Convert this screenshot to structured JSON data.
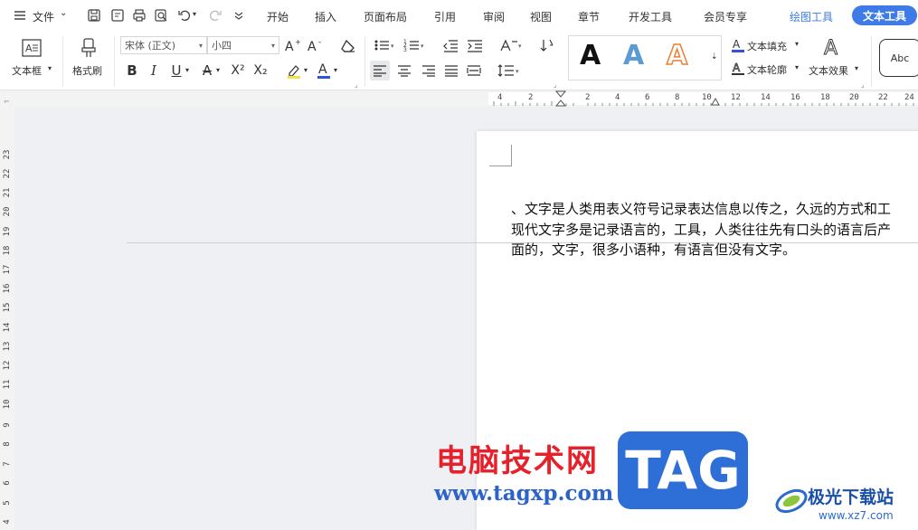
{
  "menubar": {
    "file_label": "文件",
    "tabs": [
      "开始",
      "插入",
      "页面布局",
      "引用",
      "审阅",
      "视图",
      "章节",
      "开发工具",
      "会员专享",
      "绘图工具",
      "文本工具"
    ],
    "active_tab": "文本工具"
  },
  "ribbon": {
    "textbox_label": "文本框",
    "format_painter_label": "格式刷",
    "font_name": "宋体 (正文)",
    "font_size": "小四",
    "text_fill_label": "文本填充",
    "text_outline_label": "文本轮廓",
    "text_effect_label": "文本效果",
    "style_sample_letter": "A",
    "abc_label": "Abc",
    "accent_color": "#3f7be6"
  },
  "ruler": {
    "top_numbers": [
      "4",
      "2",
      "2",
      "4",
      "6",
      "8",
      "10",
      "12",
      "14",
      "16",
      "18",
      "20",
      "22",
      "24"
    ],
    "left_numbers": [
      "23",
      "22",
      "21",
      "20",
      "19",
      "18",
      "17",
      "16",
      "15",
      "14",
      "13",
      "12",
      "11",
      "10",
      "9",
      "8",
      "7",
      "6",
      "5",
      "4"
    ]
  },
  "document": {
    "lines": [
      "、文字是人类用表义符号记录表达信息以传之，久远的方式和工",
      "现代文字多是记录语言的，工具，人类往往先有口头的语言后产",
      "面的，文字，很多小语种，有语言但没有文字。"
    ]
  },
  "watermark": {
    "title": "电脑技术网",
    "url": "www.tagxp.com",
    "tag": "TAG",
    "site_name": "极光下载站",
    "site_url": "www.xz7.com"
  }
}
